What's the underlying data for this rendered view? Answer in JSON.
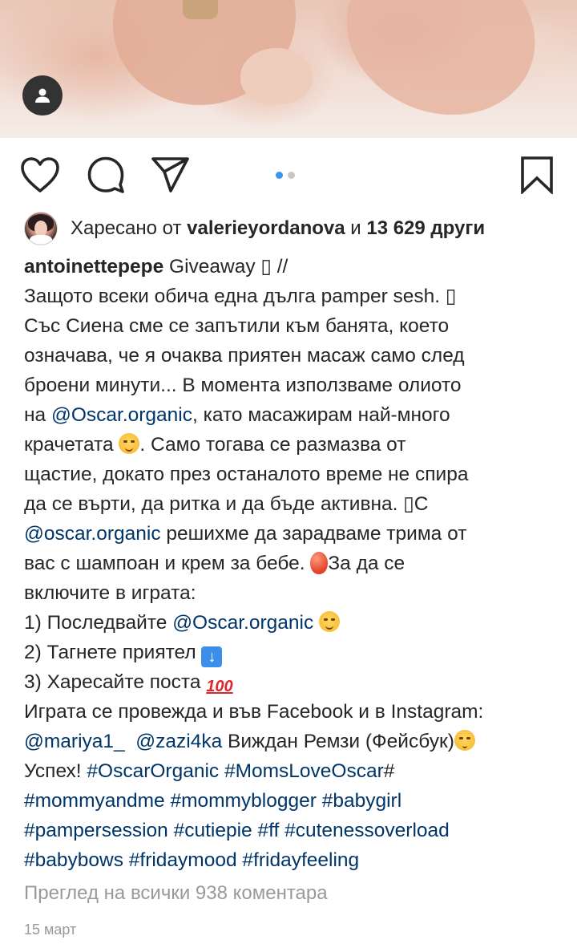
{
  "post": {
    "image_alt_icon": "user-icon",
    "carousel": {
      "count": 2,
      "active_index": 0
    },
    "likes": {
      "prefix": "Харесано от",
      "user": "valerieyordanova",
      "joiner": "и",
      "others": "13 629 други"
    },
    "caption": {
      "username": "antoinettepepe",
      "lines": {
        "l1": " Giveaway \u0000 //",
        "l2": "Защото всеки обича една дълга pamper sesh. \u0000",
        "l3": "Със Сиена сме се запътили към банята, което",
        "l4": "означава, че я очаква приятен масаж само след",
        "l5": "броени минути... В момента използваме олиото",
        "l6a": "на ",
        "l6b": "@Oscar.organic",
        "l6c": ", като масажирам най-много",
        "l7a": "крачетата ",
        "l7b": ". Само тогава се размазва от",
        "l8": "щастие, докато през останалото време не спира",
        "l9": "да се върти, да ритка и да бъде активна. \u0000С",
        "l10a": "@oscar.organic",
        "l10b": " решихме да зарадваме трима от",
        "l11a": "вас с шампоан и крем за бебе. ",
        "l11b": "За да се",
        "l12": "включите в играта:",
        "l13a": "1) Последвайте ",
        "l13b": "@Oscar.organic",
        "l14a": "2) Тагнете приятел ",
        "l15a": "3) Харесайте поста ",
        "l16": "Играта се провежда и във Facebook и в Instagram:",
        "l17a": "@mariya1_",
        "l17b": "@zazi4ka",
        "l17c": "  Виждан Ремзи (Фейсбук)",
        "l18a": "Успех! ",
        "l18b": "#OscarOrganic",
        "l18c": "#MomsLoveOscar",
        "l18d": "#",
        "l19a": "#mommyandme",
        "l19b": "#mommyblogger",
        "l19c": "#babygirl",
        "l20a": "#pampersession",
        "l20b": "#cutiepie",
        "l20c": "#ff",
        "l20d": "#cutenessoverload",
        "l21a": "#babybows",
        "l21b": "#fridaymood",
        "l21c": "#fridayfeeling"
      }
    },
    "view_comments": "Преглед на всички 938 коментара",
    "date": "15 март",
    "icons": {
      "like": "heart-icon",
      "comment": "comment-icon",
      "share": "send-icon",
      "save": "bookmark-icon"
    },
    "colors": {
      "link": "#003569",
      "text": "#262626",
      "muted": "#999999",
      "carousel_active": "#3897f0"
    }
  }
}
